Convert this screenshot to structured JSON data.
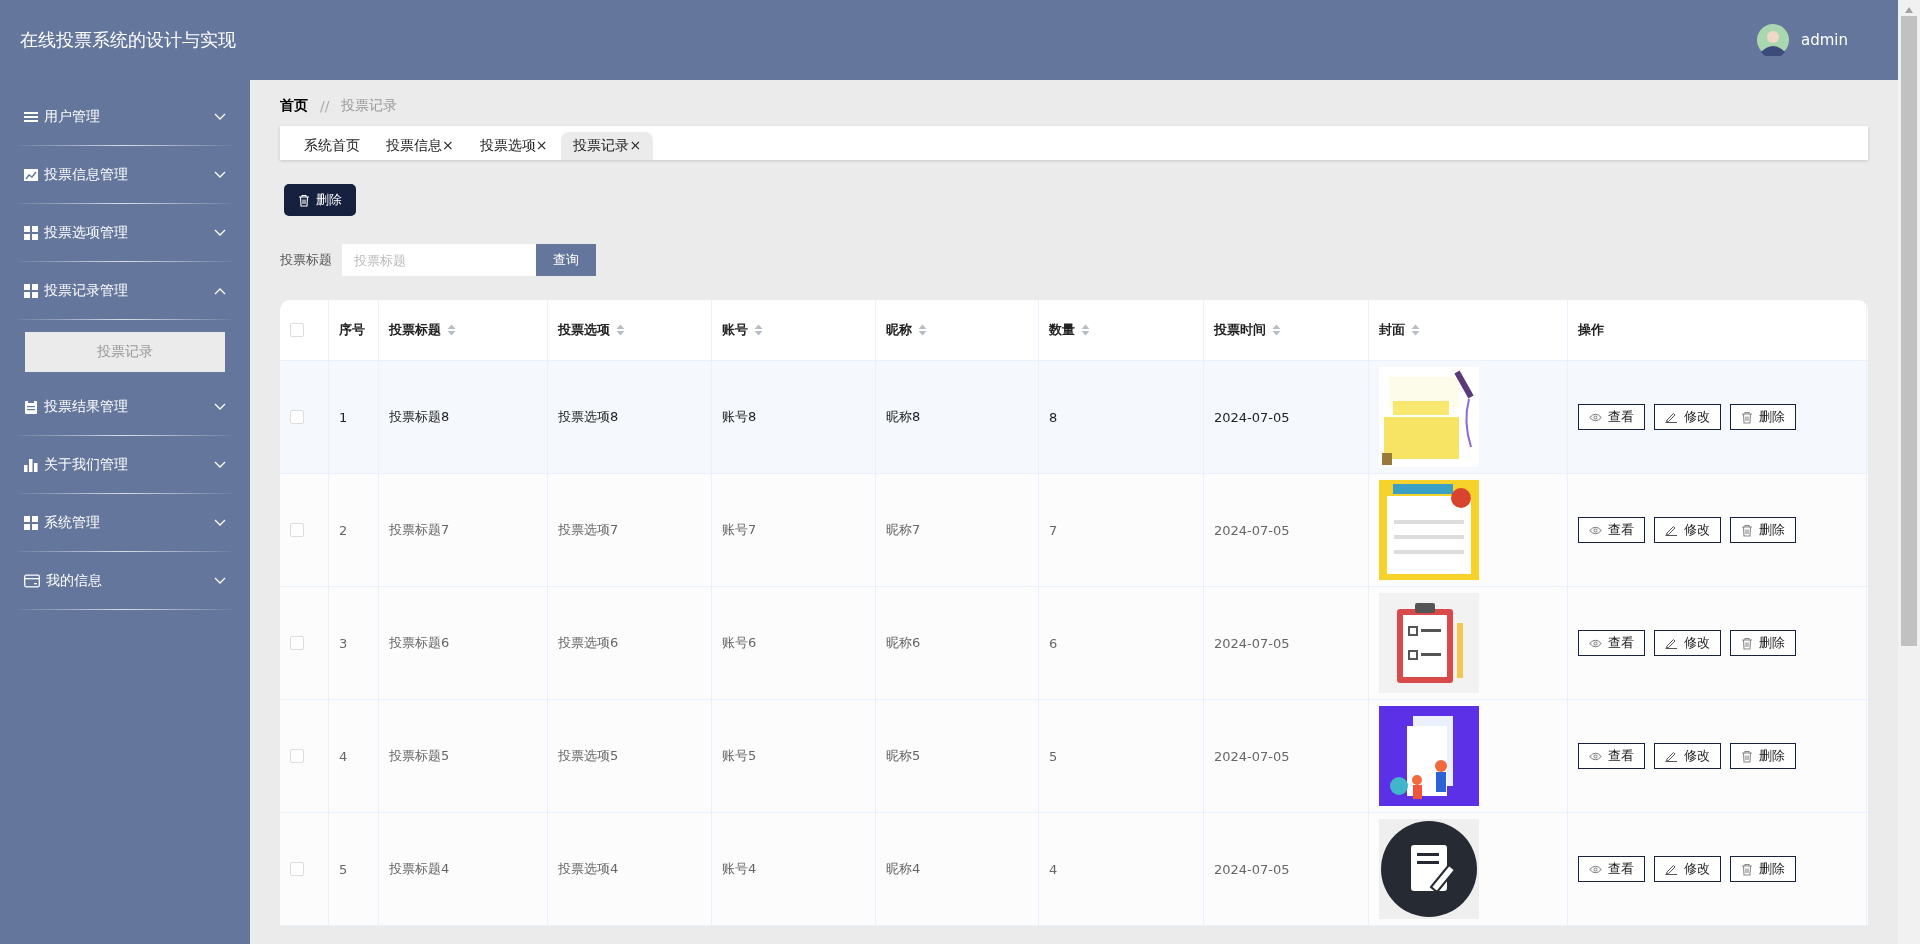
{
  "header": {
    "title": "在线投票系统的设计与实现",
    "user": "admin"
  },
  "sidebar": {
    "items": [
      {
        "label": "用户管理",
        "kind": "list",
        "expanded": false
      },
      {
        "label": "投票信息管理",
        "kind": "chart",
        "expanded": false
      },
      {
        "label": "投票选项管理",
        "kind": "grid",
        "expanded": false
      },
      {
        "label": "投票记录管理",
        "kind": "grid",
        "expanded": true,
        "children": [
          {
            "label": "投票记录",
            "selected": true
          }
        ]
      },
      {
        "label": "投票结果管理",
        "kind": "clipboard",
        "expanded": false
      },
      {
        "label": "关于我们管理",
        "kind": "bars",
        "expanded": false
      },
      {
        "label": "系统管理",
        "kind": "grid",
        "expanded": false
      },
      {
        "label": "我的信息",
        "kind": "card",
        "expanded": false
      }
    ]
  },
  "breadcrumb": {
    "items": [
      "首页",
      "投票记录"
    ],
    "separator": "//"
  },
  "tabs": [
    {
      "label": "系统首页",
      "selected": false
    },
    {
      "label": "投票信息",
      "close": "×",
      "selected": false
    },
    {
      "label": "投票选项",
      "close": "×",
      "selected": false
    },
    {
      "label": "投票记录",
      "close": "×",
      "selected": true
    }
  ],
  "toolbar": {
    "delete_button": "删除"
  },
  "search": {
    "label": "投票标题",
    "placeholder": "投票标题",
    "button": "查询"
  },
  "table": {
    "all_checked": false,
    "columns": [
      {
        "label": "序号",
        "sortable": false
      },
      {
        "label": "投票标题",
        "sortable": true
      },
      {
        "label": "投票选项",
        "sortable": true
      },
      {
        "label": "账号",
        "sortable": true
      },
      {
        "label": "昵称",
        "sortable": true
      },
      {
        "label": "数量",
        "sortable": true
      },
      {
        "label": "投票时间",
        "sortable": true
      },
      {
        "label": "封面",
        "sortable": true
      },
      {
        "label": "操作",
        "sortable": false
      }
    ],
    "rows": [
      {
        "cells": [
          "1",
          "投票标题8",
          "投票选项8",
          "账号8",
          "昵称8",
          "8",
          "2024-07-05"
        ],
        "checked": false,
        "highlighted": true,
        "actions": [
          "查看",
          "修改",
          "删除"
        ]
      },
      {
        "cells": [
          "2",
          "投票标题7",
          "投票选项7",
          "账号7",
          "昵称7",
          "7",
          "2024-07-05"
        ],
        "checked": false,
        "highlighted": false,
        "actions": [
          "查看",
          "修改",
          "删除"
        ]
      },
      {
        "cells": [
          "3",
          "投票标题6",
          "投票选项6",
          "账号6",
          "昵称6",
          "6",
          "2024-07-05"
        ],
        "checked": false,
        "highlighted": false,
        "actions": [
          "查看",
          "修改",
          "删除"
        ]
      },
      {
        "cells": [
          "4",
          "投票标题5",
          "投票选项5",
          "账号5",
          "昵称5",
          "5",
          "2024-07-05"
        ],
        "checked": false,
        "highlighted": false,
        "actions": [
          "查看",
          "修改",
          "删除"
        ]
      },
      {
        "cells": [
          "5",
          "投票标题4",
          "投票选项4",
          "账号4",
          "昵称4",
          "4",
          "2024-07-05"
        ],
        "checked": false,
        "highlighted": false,
        "actions": [
          "查看",
          "修改",
          "删除"
        ]
      }
    ]
  }
}
